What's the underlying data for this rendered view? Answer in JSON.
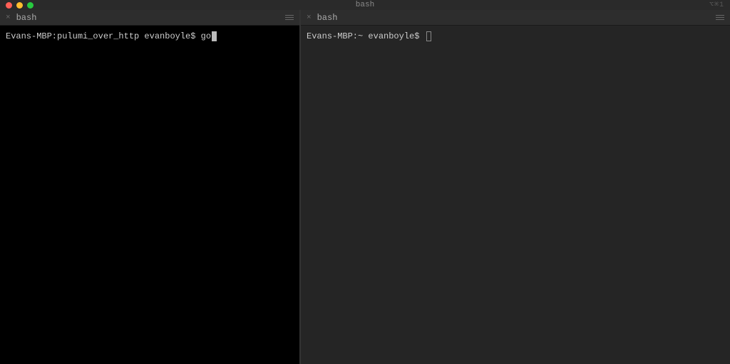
{
  "titlebar": {
    "title": "bash",
    "right_indicator": "⌥⌘1"
  },
  "panes": [
    {
      "tab_label": "bash",
      "prompt": "Evans-MBP:pulumi_over_http evanboyle$ ",
      "typed": "go",
      "cursor_style": "block"
    },
    {
      "tab_label": "bash",
      "prompt": "Evans-MBP:~ evanboyle$ ",
      "typed": "",
      "cursor_style": "outline"
    }
  ]
}
